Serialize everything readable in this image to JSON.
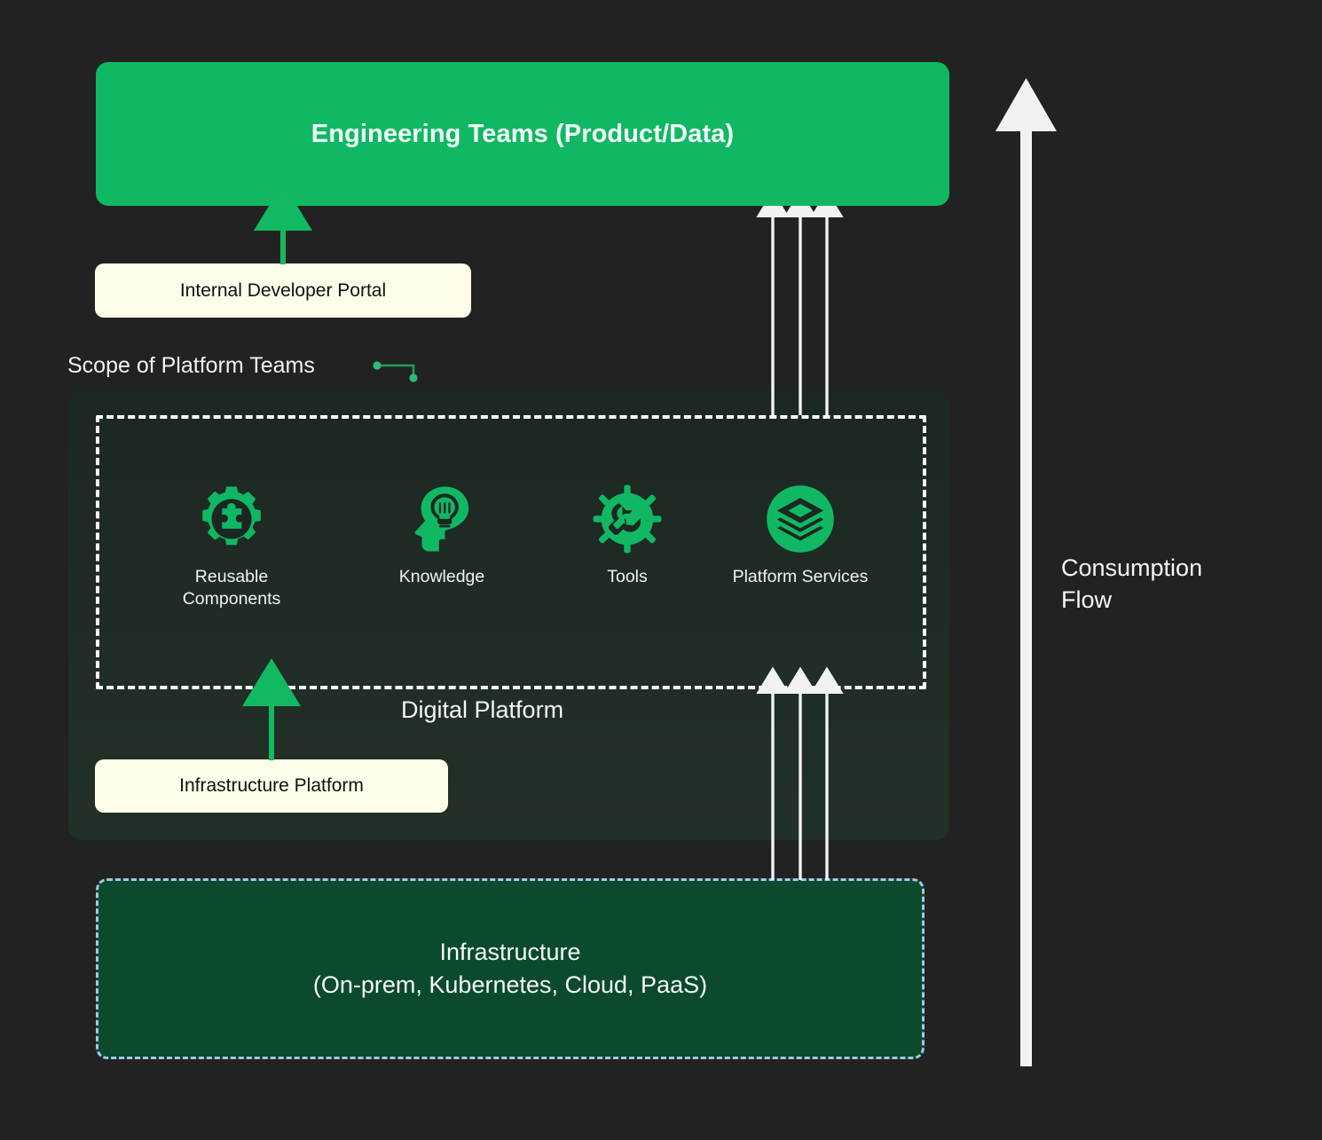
{
  "colors": {
    "background": "#222222",
    "accent_green": "#10b863",
    "panel_green": "#1f2c25",
    "cream": "#fdfde9",
    "infra_green": "#0c4a2d",
    "infra_border_blue": "#a9c2ea",
    "arrow_white": "#f2f2f2",
    "text_light": "#f2f6f3",
    "text_dark": "#111111"
  },
  "top": {
    "engineering_teams": "Engineering Teams (Product/Data)"
  },
  "portal": {
    "internal_developer_portal": "Internal Developer Portal"
  },
  "scope": {
    "label": "Scope of Platform Teams",
    "connector_icon": "elbow-connector-icon"
  },
  "platform": {
    "digital_platform": "Digital Platform",
    "capabilities": [
      {
        "label": "Reusable\nComponents",
        "icon": "gear-puzzle-icon"
      },
      {
        "label": "Knowledge",
        "icon": "head-lightbulb-icon"
      },
      {
        "label": "Tools",
        "icon": "cog-wrench-icon"
      },
      {
        "label": "Platform\nServices",
        "icon": "layers-circle-icon"
      }
    ]
  },
  "infrastructure_platform": {
    "label": "Infrastructure Platform"
  },
  "infrastructure": {
    "label": "Infrastructure\n(On-prem, Kubernetes, Cloud, PaaS)"
  },
  "consumption": {
    "label": "Consumption\nFlow",
    "arrow_icon": "up-arrow-icon"
  },
  "flows": {
    "portal_to_teams": "up-arrow-green-icon",
    "platform_to_teams": "triple-up-arrow-white-icon",
    "infra_platform_to_platform": "up-arrow-green-icon",
    "infra_to_platform": "triple-up-arrow-white-icon"
  }
}
